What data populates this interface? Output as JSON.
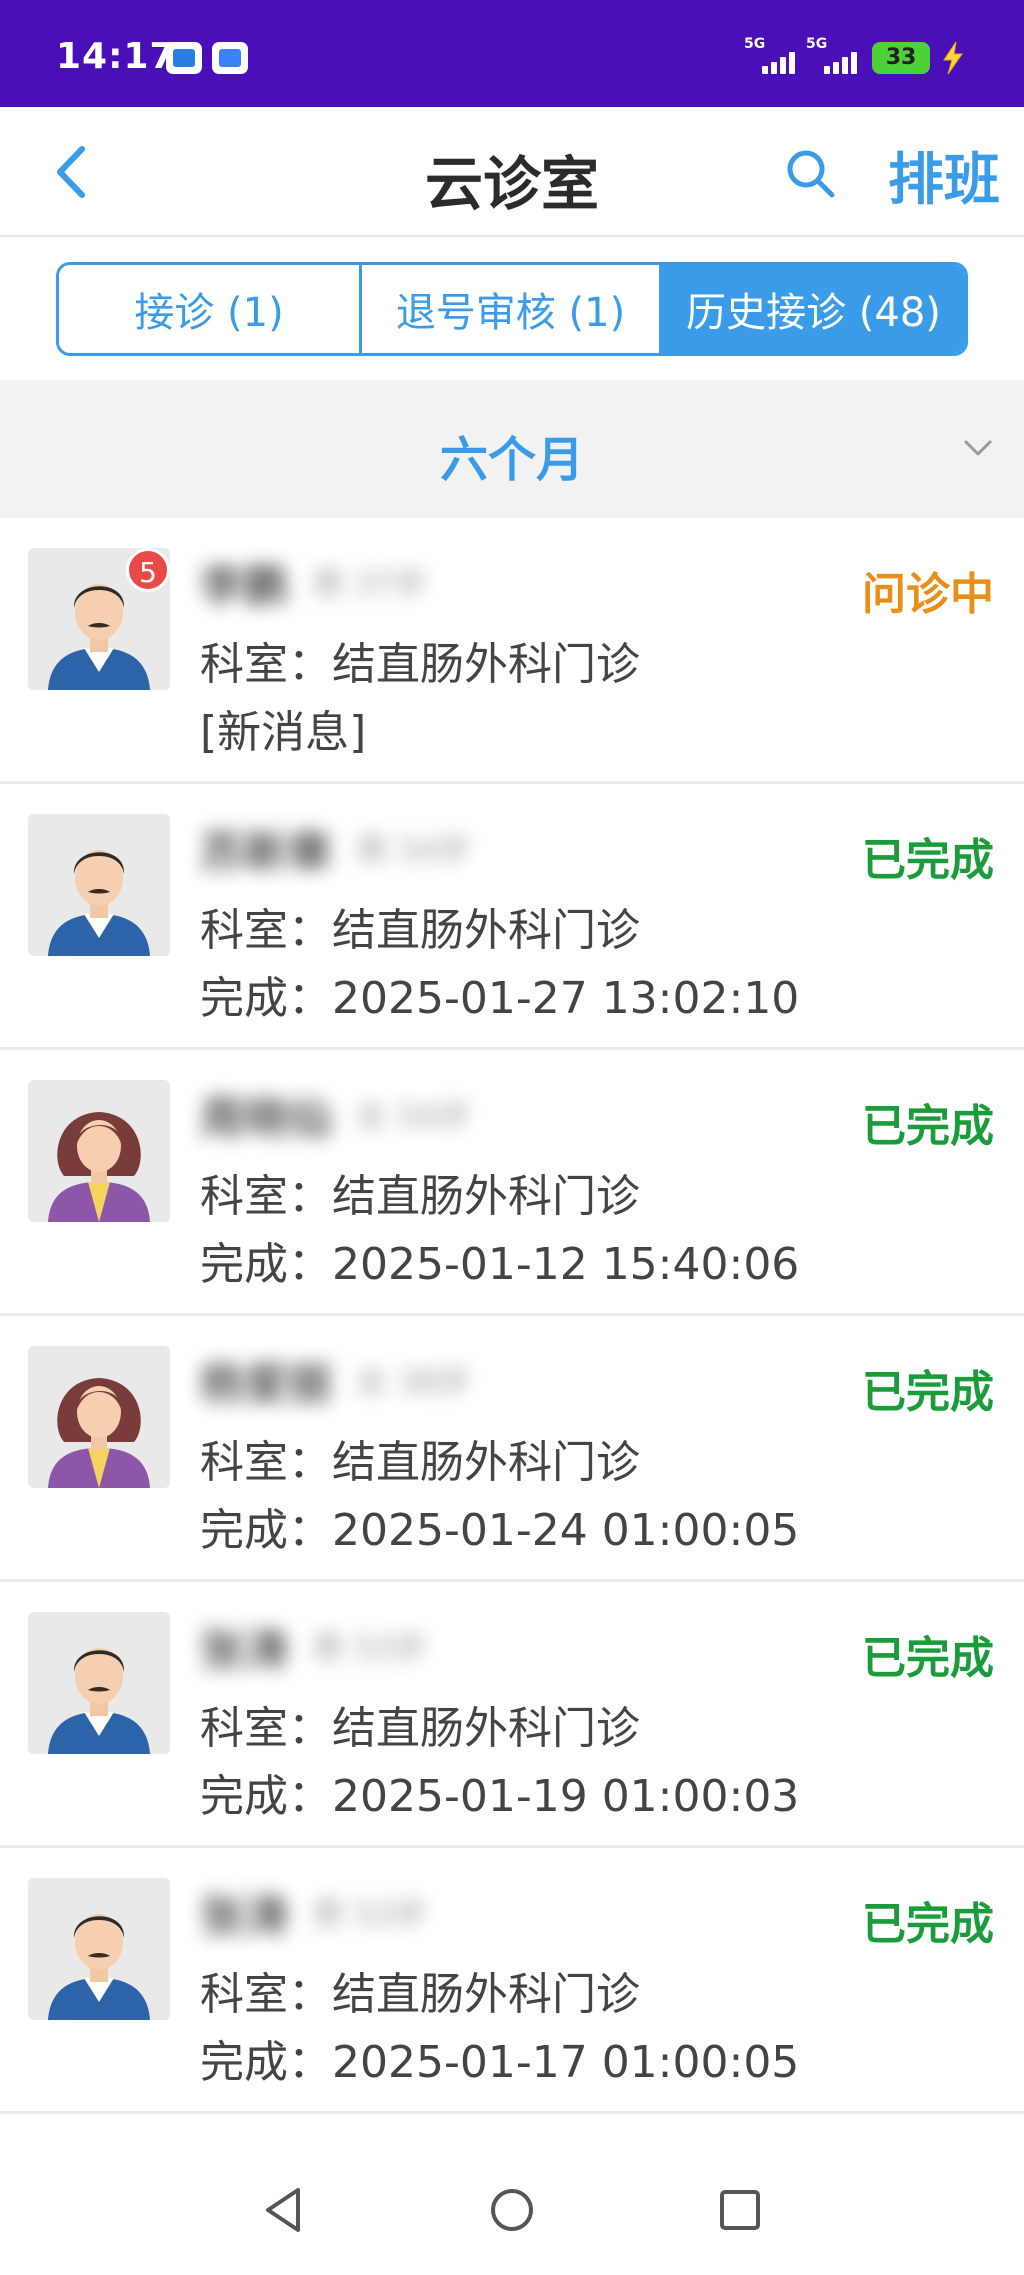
{
  "status_bar": {
    "time": "14:17",
    "signal1_label": "5G",
    "signal2_label": "5G",
    "battery": "33"
  },
  "header": {
    "title": "云诊室",
    "back_icon": "back-icon",
    "search_icon": "search-icon",
    "schedule_label": "排班"
  },
  "tabs": [
    {
      "label": "接诊 (1)",
      "active": false
    },
    {
      "label": "退号审核 (1)",
      "active": false
    },
    {
      "label": "历史接诊 (48)",
      "active": true
    }
  ],
  "filter": {
    "label": "六个月"
  },
  "colors": {
    "accent": "#3a9ce8",
    "status_bar": "#4a0fb8",
    "in_progress": "#e88f1a",
    "completed": "#1a9c3a",
    "badge": "#e84a4a"
  },
  "patients": [
    {
      "name": "李鹏",
      "sex_age": "男 37岁",
      "gender": "male",
      "status": "问诊中",
      "dept_label": "科室：",
      "dept": "结直肠外科门诊",
      "line2": "[新消息]",
      "badge": "5"
    },
    {
      "name": "苏新章",
      "sex_age": "男 54岁",
      "gender": "male",
      "status": "已完成",
      "dept_label": "科室：",
      "dept": "结直肠外科门诊",
      "line2": "完成：2025-01-27 13:02:10",
      "badge": ""
    },
    {
      "name": "周晓仙",
      "sex_age": "女 54岁",
      "gender": "female",
      "status": "已完成",
      "dept_label": "科室：",
      "dept": "结直肠外科门诊",
      "line2": "完成：2025-01-12 15:40:06",
      "badge": ""
    },
    {
      "name": "杨爱丽",
      "sex_age": "女 38岁",
      "gender": "female",
      "status": "已完成",
      "dept_label": "科室：",
      "dept": "结直肠外科门诊",
      "line2": "完成：2025-01-24 01:00:05",
      "badge": ""
    },
    {
      "name": "张涛",
      "sex_age": "男 53岁",
      "gender": "male",
      "status": "已完成",
      "dept_label": "科室：",
      "dept": "结直肠外科门诊",
      "line2": "完成：2025-01-19 01:00:03",
      "badge": ""
    },
    {
      "name": "张涛",
      "sex_age": "男 53岁",
      "gender": "male",
      "status": "已完成",
      "dept_label": "科室：",
      "dept": "结直肠外科门诊",
      "line2": "完成：2025-01-17 01:00:05",
      "badge": ""
    }
  ]
}
